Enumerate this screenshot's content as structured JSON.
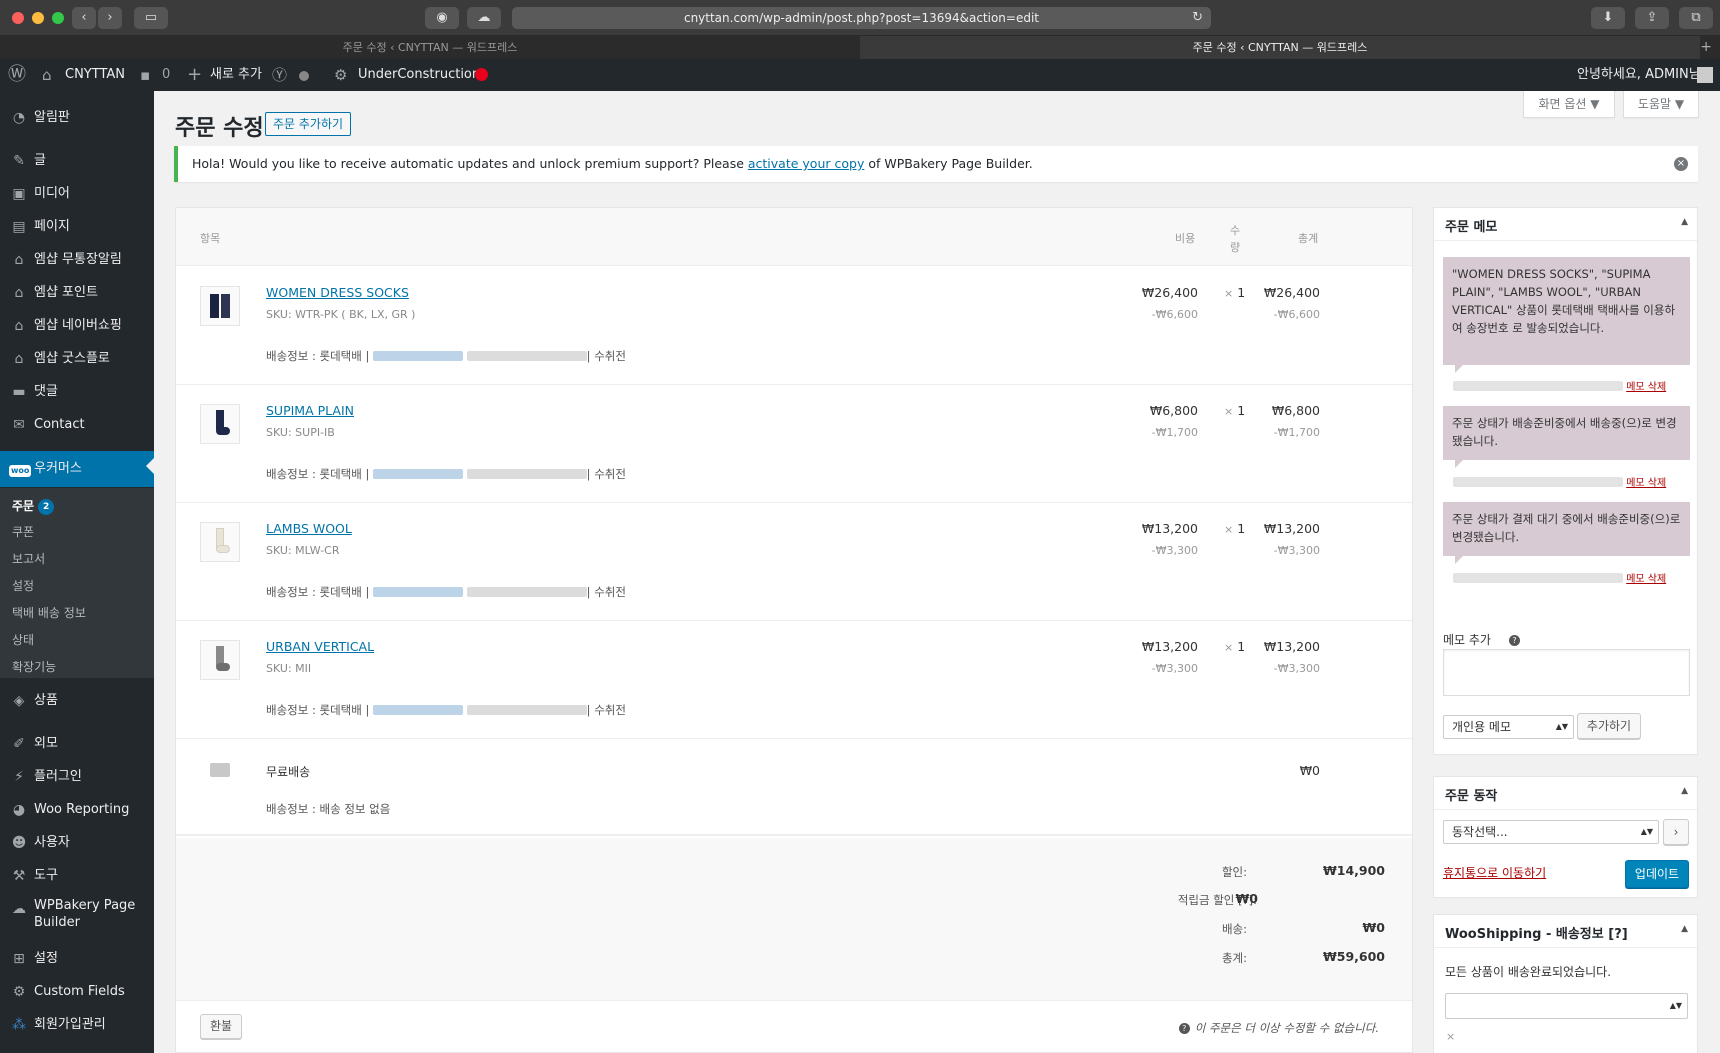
{
  "browser": {
    "url": "cnyttan.com/wp-admin/post.php?post=13694&action=edit",
    "tabs": [
      {
        "label": "주문 수정 ‹ CNYTTAN — 워드프레스"
      },
      {
        "label": "주문 수정 ‹ CNYTTAN — 워드프레스"
      }
    ]
  },
  "adminbar": {
    "site_name": "CNYTTAN",
    "comments_count": "0",
    "new_label": "새로 추가",
    "under_construction": "UnderConstruction",
    "greeting": "안녕하세요, ADMIN님"
  },
  "sidebar": {
    "items": [
      {
        "label": "알림판",
        "icon": "dashboard-icon"
      },
      {
        "label": "글",
        "icon": "pin-icon"
      },
      {
        "label": "미디어",
        "icon": "media-icon"
      },
      {
        "label": "페이지",
        "icon": "page-icon"
      },
      {
        "label": "엠샵 무통장알림",
        "icon": "shop-icon"
      },
      {
        "label": "엠샵 포인트",
        "icon": "shop-icon"
      },
      {
        "label": "엠샵 네이버쇼핑",
        "icon": "shop-icon"
      },
      {
        "label": "엠샵 굿스플로",
        "icon": "shop-icon"
      },
      {
        "label": "댓글",
        "icon": "comment-icon"
      },
      {
        "label": "Contact",
        "icon": "mail-icon"
      },
      {
        "label": "우커머스",
        "icon": "woo-icon"
      },
      {
        "label": "상품",
        "icon": "product-icon"
      },
      {
        "label": "외모",
        "icon": "appearance-icon"
      },
      {
        "label": "플러그인",
        "icon": "plugin-icon"
      },
      {
        "label": "Woo Reporting",
        "icon": "chart-icon"
      },
      {
        "label": "사용자",
        "icon": "user-icon"
      },
      {
        "label": "도구",
        "icon": "wrench-icon"
      },
      {
        "label": "WPBakery Page Builder",
        "icon": "wpbakery-icon"
      },
      {
        "label": "설정",
        "icon": "settings-icon"
      },
      {
        "label": "Custom Fields",
        "icon": "gear-icon"
      },
      {
        "label": "회원가입관리",
        "icon": "members-icon"
      }
    ],
    "woo_submenu": {
      "orders_label": "주문",
      "orders_count": "2",
      "items": [
        "쿠폰",
        "보고서",
        "설정",
        "택배 배송 정보",
        "상태",
        "확장기능"
      ]
    }
  },
  "header": {
    "title": "주문 수정",
    "add_order": "주문 추가하기",
    "screen_options": "화면 옵션 ▼",
    "help": "도움말 ▼"
  },
  "notice": {
    "before": "Hola! Would you like to receive automatic updates and unlock premium support? Please ",
    "link": "activate your copy",
    "after": " of WPBakery Page Builder."
  },
  "items_table": {
    "headers": {
      "item": "항목",
      "cost": "비용",
      "qty_line1": "수",
      "qty_line2": "량",
      "total": "총계"
    },
    "rows": [
      {
        "name": "WOMEN DRESS SOCKS",
        "sku_label": "SKU:",
        "sku": "WTR-PK ( BK, LX, GR )",
        "cost": "₩26,400",
        "cost_discount": "-₩6,600",
        "qty": "1",
        "total": "₩26,400",
        "total_discount": "-₩6,600",
        "ship_prefix": "배송정보 : 롯데택배 |",
        "ship_suffix": "| 수취전"
      },
      {
        "name": "SUPIMA PLAIN",
        "sku_label": "SKU:",
        "sku": "SUPI-IB",
        "cost": "₩6,800",
        "cost_discount": "-₩1,700",
        "qty": "1",
        "total": "₩6,800",
        "total_discount": "-₩1,700",
        "ship_prefix": "배송정보 : 롯데택배 |",
        "ship_suffix": "| 수취전"
      },
      {
        "name": "LAMBS WOOL",
        "sku_label": "SKU:",
        "sku": "MLW-CR",
        "cost": "₩13,200",
        "cost_discount": "-₩3,300",
        "qty": "1",
        "total": "₩13,200",
        "total_discount": "-₩3,300",
        "ship_prefix": "배송정보 : 롯데택배 |",
        "ship_suffix": "| 수취전"
      },
      {
        "name": "URBAN VERTICAL",
        "sku_label": "SKU:",
        "sku": "MII",
        "cost": "₩13,200",
        "cost_discount": "-₩3,300",
        "qty": "1",
        "total": "₩13,200",
        "total_discount": "-₩3,300",
        "ship_prefix": "배송정보 : 롯데택배 |",
        "ship_suffix": "| 수취전"
      }
    ],
    "qty_x": "×",
    "shipping": {
      "name": "무료배송",
      "cost": "₩0",
      "info": "배송정보 : 배송 정보 없음"
    },
    "totals": {
      "discount_label": "할인:",
      "discount": "₩14,900",
      "points_label": "적립금 할인 [?]:",
      "points": "₩0",
      "shipping_label": "배송:",
      "shipping": "₩0",
      "total_label": "총계:",
      "total": "₩59,600"
    },
    "refund": "환불",
    "locked_note": "이 주문은 더 이상 수정할 수 없습니다."
  },
  "order_notes": {
    "title": "주문 메모",
    "notes": [
      {
        "text": "\"WOMEN DRESS SOCKS\", \"SUPIMA PLAIN\", \"LAMBS WOOL\", \"URBAN VERTICAL\" 상품이 롯데택배 택배사를 이용하여 송장번호 로 발송되었습니다.",
        "delete": "메모 삭제"
      },
      {
        "text": "주문 상태가 배송준비중에서 배송중(으)로 변경됐습니다.",
        "delete": "메모 삭제"
      },
      {
        "text": "주문 상태가 결제 대기 중에서 배송준비중(으)로 변경됐습니다.",
        "delete": "메모 삭제"
      }
    ],
    "add_label": "메모 추가",
    "note_type": "개인용 메모",
    "add_button": "추가하기"
  },
  "order_actions": {
    "title": "주문 동작",
    "select": "동작선택...",
    "go": "›",
    "trash": "휴지통으로 이동하기",
    "update": "업데이트"
  },
  "wooshipping": {
    "title": "WooShipping - 배송정보 [?]",
    "status": "모든 상품이 배송완료되었습니다.",
    "close": "×"
  }
}
